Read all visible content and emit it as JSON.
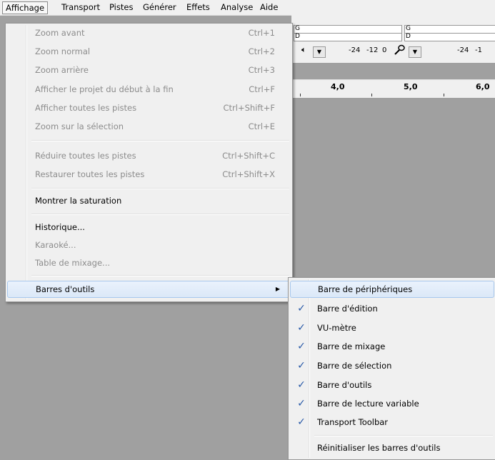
{
  "menubar": {
    "items": [
      {
        "label": "Affichage",
        "active": true
      },
      {
        "label": "Transport"
      },
      {
        "label": "Pistes"
      },
      {
        "label": "Générer"
      },
      {
        "label": "Effets"
      },
      {
        "label": "Analyse"
      },
      {
        "label": "Aide"
      }
    ]
  },
  "toolbar": {
    "meter_left_label": "G",
    "meter_right_label": "D",
    "playback_scale": [
      "-24",
      "-12",
      "0"
    ],
    "record_scale": [
      "-24",
      "-1"
    ],
    "playback_icon": "speaker-icon",
    "record_icon": "microphone-icon",
    "dropdown_glyph": "▼"
  },
  "ruler": {
    "ticks": [
      "4,0",
      "5,0",
      "6,0"
    ]
  },
  "view_menu": {
    "items": [
      {
        "label": "Zoom avant",
        "shortcut": "Ctrl+1",
        "disabled": true
      },
      {
        "label": "Zoom normal",
        "shortcut": "Ctrl+2",
        "disabled": true
      },
      {
        "label": "Zoom arrière",
        "shortcut": "Ctrl+3",
        "disabled": true
      },
      {
        "label": "Afficher le projet du début à la fin",
        "shortcut": "Ctrl+F",
        "disabled": true
      },
      {
        "label": "Afficher toutes les pistes",
        "shortcut": "Ctrl+Shift+F",
        "disabled": true
      },
      {
        "label": "Zoom sur la sélection",
        "shortcut": "Ctrl+E",
        "disabled": true
      },
      {
        "label": "Réduire toutes les pistes",
        "shortcut": "Ctrl+Shift+C",
        "disabled": true
      },
      {
        "label": "Restaurer toutes les pistes",
        "shortcut": "Ctrl+Shift+X",
        "disabled": true
      },
      {
        "label": "Montrer la saturation",
        "shortcut": "",
        "disabled": false
      },
      {
        "label": "Historique...",
        "shortcut": "",
        "disabled": false
      },
      {
        "label": "Karaoké...",
        "shortcut": "",
        "disabled": true
      },
      {
        "label": "Table de mixage...",
        "shortcut": "",
        "disabled": true
      },
      {
        "label": "Barres d'outils",
        "shortcut": "",
        "disabled": false,
        "submenu": true
      }
    ],
    "submenu_arrow": "▶"
  },
  "toolbars_submenu": {
    "check_glyph": "✓",
    "items": [
      {
        "label": "Barre de périphériques",
        "checked": false
      },
      {
        "label": "Barre d'édition",
        "checked": true
      },
      {
        "label": "VU-mètre",
        "checked": true
      },
      {
        "label": "Barre de mixage",
        "checked": true
      },
      {
        "label": "Barre de sélection",
        "checked": true
      },
      {
        "label": "Barre d'outils",
        "checked": true
      },
      {
        "label": "Barre de lecture variable",
        "checked": true
      },
      {
        "label": "Transport Toolbar",
        "checked": true
      },
      {
        "label": "Réinitialiser les barres d'outils",
        "checked": false
      }
    ]
  }
}
